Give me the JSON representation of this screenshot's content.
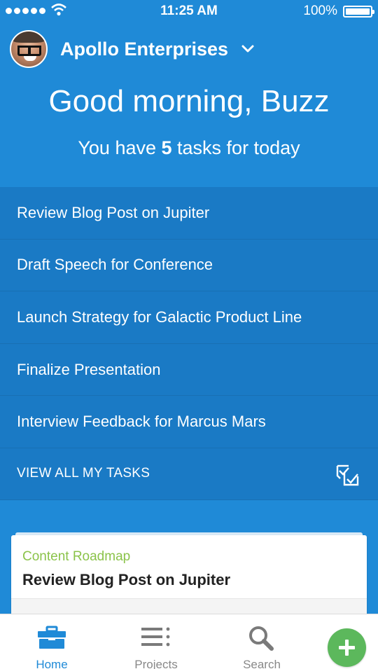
{
  "status_bar": {
    "time": "11:25 AM",
    "battery": "100%",
    "icons": [
      "signal-dots-icon",
      "wifi-icon",
      "battery-icon"
    ]
  },
  "header": {
    "account_name": "Apollo Enterprises",
    "greeting": "Good morning, Buzz",
    "summary_prefix": "You have ",
    "task_count": "5",
    "summary_suffix": " tasks for today"
  },
  "tasks": [
    "Review Blog Post on Jupiter",
    "Draft Speech for Conference",
    "Launch Strategy for Galactic Product Line",
    "Finalize Presentation",
    "Interview Feedback for Marcus Mars"
  ],
  "view_all": {
    "label": "VIEW ALL MY TASKS",
    "icon": "checklist-icon"
  },
  "card": {
    "project": "Content Roadmap",
    "title": "Review Blog Post on Jupiter"
  },
  "tab_bar": {
    "home": "Home",
    "projects": "Projects",
    "search": "Search",
    "add_icon": "plus-icon"
  },
  "colors": {
    "background": "#1f8ad7",
    "task_list": "#1a7ac5",
    "project_label": "#8bc34a",
    "fab": "#5cb85c",
    "active_tab": "#1f8ad7"
  }
}
